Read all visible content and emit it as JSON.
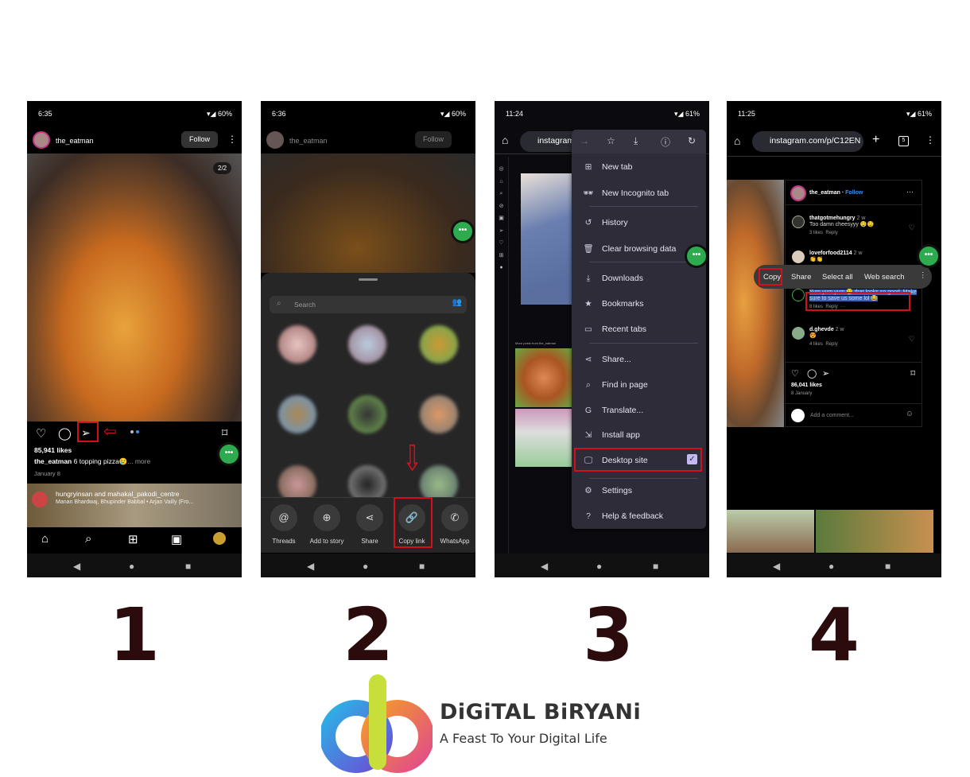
{
  "step_numbers": [
    "1",
    "2",
    "3",
    "4"
  ],
  "phone1": {
    "status": {
      "time": "6:35",
      "battery": "60%"
    },
    "username": "the_eatman",
    "follow_label": "Follow",
    "page_counter": "2/2",
    "likes": "85,941 likes",
    "caption_user": "the_eatman",
    "caption_text": "6 topping pizza😢",
    "more": "... more",
    "date": "January 8",
    "next_post": {
      "title": "hungryinsan and mahakal_pakodi_centre",
      "subtitle": "Manan Bhardwaj, Bhupinder Babbal • Arjan Vailly (Fro..."
    },
    "icons": [
      "heart-icon",
      "comment-icon",
      "share-send-icon",
      "bookmark-icon"
    ],
    "annotation": "red arrow pointing to share icon"
  },
  "phone2": {
    "status": {
      "time": "6:36",
      "battery": "60%"
    },
    "username": "the_eatman",
    "follow_label": "Follow",
    "search_placeholder": "Search",
    "share_options": [
      {
        "label": "Threads",
        "icon": "@"
      },
      {
        "label": "Add to story",
        "icon": "⊕"
      },
      {
        "label": "Share",
        "icon": "⋖"
      },
      {
        "label": "Copy link",
        "icon": "🔗"
      },
      {
        "label": "WhatsApp",
        "icon": "✆"
      }
    ]
  },
  "phone3": {
    "status": {
      "time": "11:24",
      "battery": "61%"
    },
    "url": "instagram",
    "more_posts_label": "More posts from the_eatman",
    "menu_items": [
      {
        "label": "New tab",
        "icon": "⊞"
      },
      {
        "label": "New Incognito tab",
        "icon": "🕶"
      },
      {
        "label": "History",
        "icon": "↺"
      },
      {
        "label": "Clear browsing data",
        "icon": "🗑"
      },
      {
        "label": "Downloads",
        "icon": "⤓"
      },
      {
        "label": "Bookmarks",
        "icon": "★"
      },
      {
        "label": "Recent tabs",
        "icon": "▭"
      },
      {
        "label": "Share...",
        "icon": "⋖"
      },
      {
        "label": "Find in page",
        "icon": "⌕"
      },
      {
        "label": "Translate...",
        "icon": "G"
      },
      {
        "label": "Install app",
        "icon": "⇲"
      },
      {
        "label": "Desktop site",
        "icon": "🖵",
        "checked": true
      },
      {
        "label": "Settings",
        "icon": "⚙"
      },
      {
        "label": "Help & feedback",
        "icon": "?"
      }
    ]
  },
  "phone4": {
    "status": {
      "time": "11:25",
      "battery": "61%"
    },
    "url": "instagram.com/p/C12EN",
    "tab_count": "5",
    "username": "the_eatman",
    "follow_label": "Follow",
    "comments": [
      {
        "user": "thatgotmehungry",
        "age": "2 w",
        "text": "Too damn cheesyyy 🤤🤤",
        "likes": "3 likes",
        "reply": "Reply"
      },
      {
        "user": "loveforfood2114",
        "age": "2 w",
        "text": "👏👏",
        "likes": "",
        "reply": ""
      },
      {
        "user": "",
        "age": "",
        "text": "Yum yum yum 😋 that looks so good. Make sure to save us some lol 😂",
        "likes": "8 likes",
        "reply": "Reply"
      },
      {
        "user": "d.ghevde",
        "age": "2 w",
        "text": "😍",
        "likes": "4 likes",
        "reply": "Reply"
      }
    ],
    "context_menu": [
      "Copy",
      "Share",
      "Select all",
      "Web search"
    ],
    "likes": "86,041 likes",
    "date": "8 January",
    "comment_placeholder": "Add a comment..."
  },
  "logo": {
    "brand": "DiGiTAL BiRYANi",
    "tagline": "A Feast To Your Digital Life"
  },
  "colors": {
    "highlight": "#d0111b",
    "green": "#2eab4e",
    "menu_bg": "#2d2c38",
    "number": "#2b0b0b"
  }
}
